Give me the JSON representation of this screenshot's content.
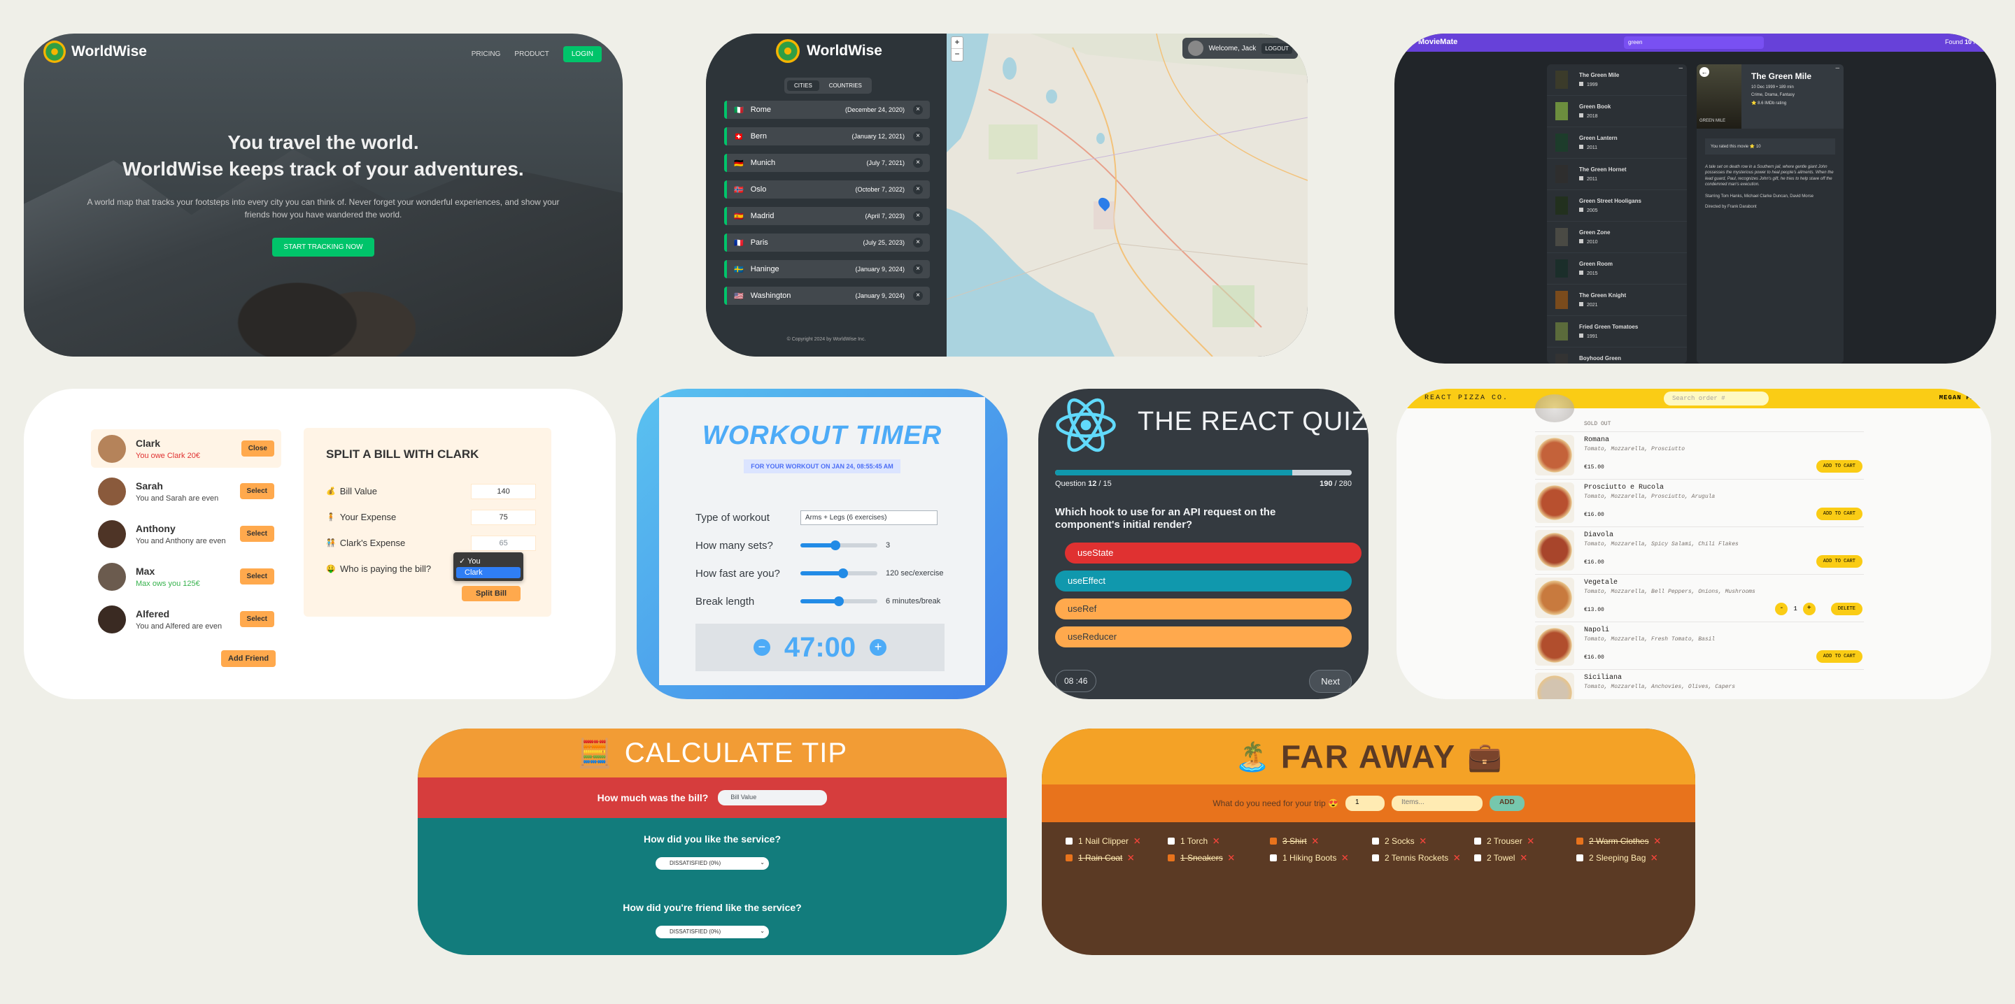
{
  "ww1": {
    "brand": "WorldWise",
    "nav": [
      "PRICING",
      "PRODUCT",
      "LOGIN"
    ],
    "h1a": "You travel the world.",
    "h1b": "WorldWise keeps track of your adventures.",
    "sub": "A world map that tracks your footsteps into every city you can think of. Never forget your wonderful experiences, and show your friends how you have wandered the world.",
    "cta": "START TRACKING NOW"
  },
  "ww2": {
    "brand": "WorldWise",
    "tabs": [
      "CITIES",
      "COUNTRIES"
    ],
    "cities": [
      {
        "flag": "🇮🇹",
        "name": "Rome",
        "date": "(December 24, 2020)"
      },
      {
        "flag": "🇨🇭",
        "name": "Bern",
        "date": "(January 12, 2021)"
      },
      {
        "flag": "🇩🇪",
        "name": "Munich",
        "date": "(July 7, 2021)"
      },
      {
        "flag": "🇳🇴",
        "name": "Oslo",
        "date": "(October 7, 2022)"
      },
      {
        "flag": "🇪🇸",
        "name": "Madrid",
        "date": "(April 7, 2023)"
      },
      {
        "flag": "🇫🇷",
        "name": "Paris",
        "date": "(July 25, 2023)"
      },
      {
        "flag": "🇸🇪",
        "name": "Haninge",
        "date": "(January 9, 2024)"
      },
      {
        "flag": "🇺🇸",
        "name": "Washington",
        "date": "(January 9, 2024)"
      }
    ],
    "delete": "×",
    "copyright": "© Copyright 2024 by WorldWise Inc.",
    "welcome": "Welcome, Jack",
    "logout": "LOGOUT",
    "zoom_in": "+",
    "zoom_out": "−"
  },
  "mm": {
    "brand": "MovieMate",
    "search": "green",
    "found_prefix": "Found ",
    "found_num": "10",
    "found_suffix": " results",
    "toggle": "–",
    "movies": [
      {
        "title": "The Green Mile",
        "year": "1999"
      },
      {
        "title": "Green Book",
        "year": "2018"
      },
      {
        "title": "Green Lantern",
        "year": "2011"
      },
      {
        "title": "The Green Hornet",
        "year": "2011"
      },
      {
        "title": "Green Street Hooligans",
        "year": "2005"
      },
      {
        "title": "Green Zone",
        "year": "2010"
      },
      {
        "title": "Green Room",
        "year": "2015"
      },
      {
        "title": "The Green Knight",
        "year": "2021"
      },
      {
        "title": "Fried Green Tomatoes",
        "year": "1991"
      },
      {
        "title": "Boyhood Green",
        "year": ""
      }
    ],
    "detail": {
      "back": "←",
      "title": "The Green Mile",
      "released": "10 Dec 1999 • 189 min",
      "genre": "Crime, Drama, Fantasy",
      "rating": "⭐ 8.6 IMDb rating",
      "rated_note": "You rated this movie ⭐ 10",
      "plot": "A tale set on death row in a Southern jail, where gentle giant John possesses the mysterious power to heal people's ailments. When the lead guard, Paul, recognizes John's gift, he tries to help stave off the condemned man's execution.",
      "starring": "Starring Tom Hanks, Michael Clarke Duncan, David Morse",
      "director": "Directed by Frank Darabont"
    },
    "poster_text": "GREEN MILE"
  },
  "split": {
    "friends": [
      {
        "name": "Clark",
        "status": "You owe Clark 20€",
        "btn": "Close",
        "tone": "red"
      },
      {
        "name": "Sarah",
        "status": "You and Sarah are even",
        "btn": "Select",
        "tone": "grey"
      },
      {
        "name": "Anthony",
        "status": "You and Anthony are even",
        "btn": "Select",
        "tone": "grey"
      },
      {
        "name": "Max",
        "status": "Max ows you 125€",
        "btn": "Select",
        "tone": "green"
      },
      {
        "name": "Alfered",
        "status": "You and Alfered are even",
        "btn": "Select",
        "tone": "grey"
      }
    ],
    "add": "Add Friend",
    "title": "SPLIT A BILL WITH CLARK",
    "rows": [
      {
        "icon": "💰",
        "label": "Bill Value",
        "val": "140"
      },
      {
        "icon": "🧍",
        "label": "Your Expense",
        "val": "75"
      },
      {
        "icon": "🧑‍🤝‍🧑",
        "label": "Clark's Expense",
        "val": "65"
      },
      {
        "icon": "🤑",
        "label": "Who is paying the bill?",
        "val": ""
      }
    ],
    "options": [
      "✓ You",
      "Clark"
    ],
    "submit": "Split Bill"
  },
  "wt": {
    "title": "WORKOUT TIMER",
    "date": "FOR YOUR WORKOUT ON JAN 24, 08:55:45 AM",
    "type_label": "Type of workout",
    "type_val": "Arms + Legs (6 exercises)",
    "sets_label": "How many sets?",
    "sets_val": "3",
    "sets_frac": 0.45,
    "speed_label": "How fast are you?",
    "speed_val": "120 sec/exercise",
    "speed_frac": 0.55,
    "break_label": "Break length",
    "break_val": "6 minutes/break",
    "break_frac": 0.5,
    "time": "47:00",
    "minus": "−",
    "plus": "+"
  },
  "quiz": {
    "title": "THE REACT QUIZ",
    "qlabel": "Question ",
    "qnum": "12",
    "qtotal": " / 15",
    "progress": 0.8,
    "pts": "190",
    "pts_total": " / 280",
    "question": "Which hook to use for an API request on the component's initial render?",
    "options": [
      "useState",
      "useEffect",
      "useRef",
      "useReducer"
    ],
    "timer": "08 :46",
    "next": "Next"
  },
  "pizza": {
    "brand": "FAST REACT PIZZA CO.",
    "search": "Search order #",
    "user": "MEGAN FANNY",
    "soldout": "SOLD OUT",
    "items": [
      {
        "name": "Romana",
        "ing": "Tomato, Mozzarella, Prosciutto",
        "price": "€15.00",
        "action": "ADD TO CART"
      },
      {
        "name": "Prosciutto e Rucola",
        "ing": "Tomato, Mozzarella, Prosciutto, Arugula",
        "price": "€16.00",
        "action": "ADD TO CART"
      },
      {
        "name": "Diavola",
        "ing": "Tomato, Mozzarella, Spicy Salami, Chili Flakes",
        "price": "€16.00",
        "action": "ADD TO CART"
      },
      {
        "name": "Vegetale",
        "ing": "Tomato, Mozzarella, Bell Peppers, Onions, Mushrooms",
        "price": "€13.00",
        "action": "DELETE"
      },
      {
        "name": "Napoli",
        "ing": "Tomato, Mozzarella, Fresh Tomato, Basil",
        "price": "€16.00",
        "action": "ADD TO CART"
      },
      {
        "name": "Siciliana",
        "ing": "Tomato, Mozzarella, Anchovies, Olives, Capers",
        "price": "",
        "action": ""
      }
    ],
    "qty": "1",
    "minus": "-",
    "plus": "+"
  },
  "tip": {
    "icon": "🧮",
    "title": "CALCULATE TIP",
    "bill_label": "How much was the bill?",
    "bill_ph": "Bill Value",
    "q1": "How did you like the service?",
    "q2": "How did you're friend like the service?",
    "sel": "DISSATISFIED (0%)"
  },
  "far": {
    "left_icon": "🏝️",
    "title": "FAR AWAY",
    "right_icon": "💼",
    "prompt": "What do you need for your trip 😍",
    "qty": "1",
    "ph": "Items...",
    "add": "ADD",
    "items": [
      {
        "label": "1 Nail Clipper",
        "done": false
      },
      {
        "label": "1 Torch",
        "done": false
      },
      {
        "label": "3 Shirt",
        "done": true
      },
      {
        "label": "2 Socks",
        "done": false
      },
      {
        "label": "2 Trouser",
        "done": false
      },
      {
        "label": "2 Warm Clothes",
        "done": true
      },
      {
        "label": "1 Rain Coat",
        "done": true
      },
      {
        "label": "1 Sneakers",
        "done": true
      },
      {
        "label": "1 Hiking Boots",
        "done": false
      },
      {
        "label": "2 Tennis Rockets",
        "done": false
      },
      {
        "label": "2 Towel",
        "done": false
      },
      {
        "label": "2 Sleeping Bag",
        "done": false
      }
    ],
    "remove": "❌"
  }
}
